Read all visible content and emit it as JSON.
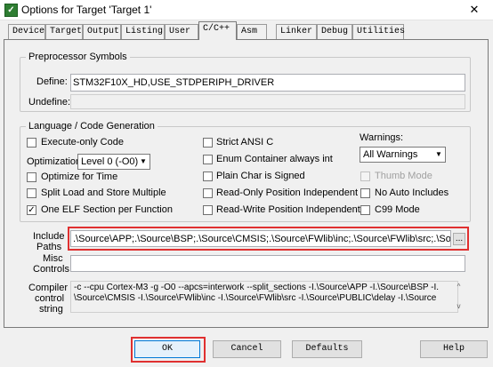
{
  "window": {
    "title": "Options for Target 'Target 1'",
    "close_glyph": "✕"
  },
  "tabs": [
    {
      "label": "Device"
    },
    {
      "label": "Target"
    },
    {
      "label": "Output"
    },
    {
      "label": "Listing"
    },
    {
      "label": "User"
    },
    {
      "label": "C/C++"
    },
    {
      "label": "Asm"
    },
    {
      "label": "Linker"
    },
    {
      "label": "Debug"
    },
    {
      "label": "Utilities"
    }
  ],
  "preprocessor": {
    "legend": "Preprocessor Symbols",
    "define_label": "Define:",
    "define_value": "STM32F10X_HD,USE_STDPERIPH_DRIVER",
    "undefine_label": "Undefine:",
    "undefine_value": ""
  },
  "language": {
    "legend": "Language / Code Generation",
    "execute_only": "Execute-only Code",
    "optimization_label": "Optimization:",
    "optimization_value": "Level 0 (-O0)",
    "optimize_time": "Optimize for Time",
    "split_load": "Split Load and Store Multiple",
    "one_elf": "One ELF Section per Function",
    "strict_ansi": "Strict ANSI C",
    "enum_container": "Enum Container always int",
    "plain_char": "Plain Char is Signed",
    "ro_pi": "Read-Only Position Independent",
    "rw_pi": "Read-Write Position Independent",
    "warnings_label": "Warnings:",
    "warnings_value": "All Warnings",
    "thumb_mode": "Thumb Mode",
    "no_auto_includes": "No Auto Includes",
    "c99_mode": "C99 Mode",
    "check_glyph": "✓"
  },
  "include_paths": {
    "label_line1": "Include",
    "label_line2": "Paths",
    "value": ".\\Source\\APP;.\\Source\\BSP;.\\Source\\CMSIS;.\\Source\\FWlib\\inc;.\\Source\\FWlib\\src;.\\Source\\PU",
    "browse_label": "..."
  },
  "misc_controls": {
    "label_line1": "Misc",
    "label_line2": "Controls",
    "value": ""
  },
  "compiler_control": {
    "label_line1": "Compiler",
    "label_line2": "control",
    "label_line3": "string",
    "line1": "-c --cpu Cortex-M3 -g -O0 --apcs=interwork --split_sections -I.\\Source\\APP -I.\\Source\\BSP -I.",
    "line2": "\\Source\\CMSIS -I.\\Source\\FWlib\\inc -I.\\Source\\FWlib\\src -I.\\Source\\PUBLIC\\delay -I.\\Source",
    "scroll_up": "^",
    "scroll_down": "v"
  },
  "buttons": {
    "ok": "OK",
    "cancel": "Cancel",
    "defaults": "Defaults",
    "help": "Help"
  },
  "colors": {
    "highlight": "#e03030"
  }
}
